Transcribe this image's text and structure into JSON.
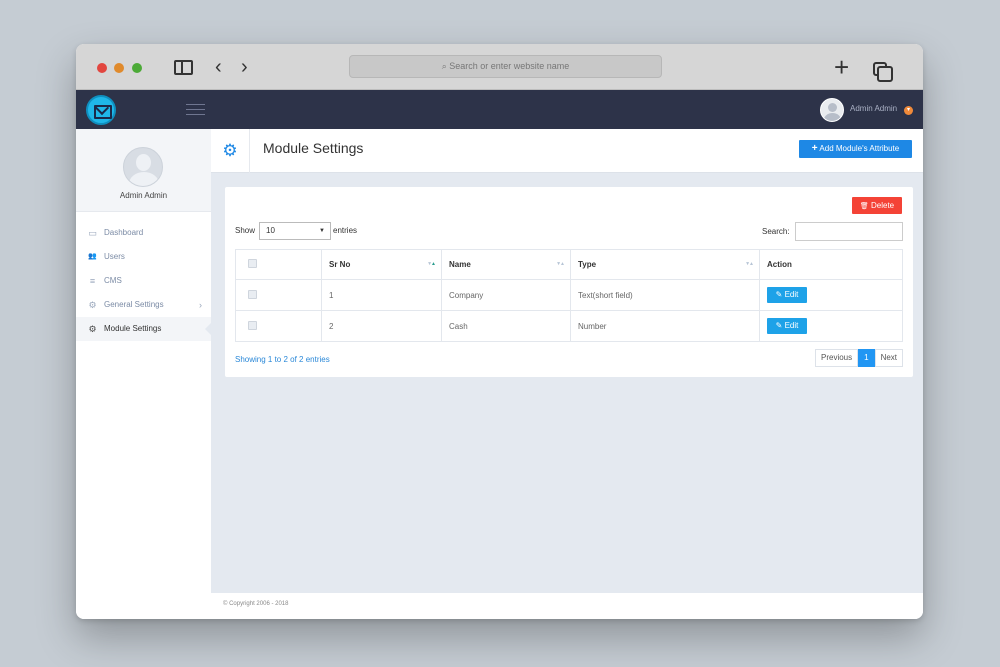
{
  "browser": {
    "url_placeholder": "Search or enter website name",
    "back_symbol": "‹",
    "forward_symbol": "›",
    "new_tab_symbol": "+"
  },
  "topbar": {
    "username": "Admin Admin",
    "logo_icon": "mail-icon",
    "colors": {
      "bar": "#2d3349",
      "logo": "#1fb7e9",
      "caret": "#f08a3a"
    }
  },
  "sidebar": {
    "profile_name": "Admin Admin",
    "items": [
      {
        "label": "Dashboard",
        "icon": "laptop-icon",
        "glyph": "▭",
        "active": false
      },
      {
        "label": "Users",
        "icon": "users-icon",
        "glyph": "👥",
        "active": false
      },
      {
        "label": "CMS",
        "icon": "list-icon",
        "glyph": "≡",
        "active": false
      },
      {
        "label": "General Settings",
        "icon": "cogs-icon",
        "glyph": "⚙",
        "active": false,
        "has_submenu": true
      },
      {
        "label": "Module Settings",
        "icon": "gear-icon",
        "glyph": "⚙",
        "active": true
      }
    ]
  },
  "header": {
    "title": "Module Settings",
    "add_button_label": "Add Module's Attribute",
    "add_icon": "+",
    "accent": "#1e88e5"
  },
  "panel": {
    "delete_label": "Delete",
    "delete_icon": "🗑",
    "delete_color": "#f44336",
    "show_label": "Show",
    "page_size": "10",
    "entries_label": "entries",
    "search_label": "Search:",
    "search_value": "",
    "columns": [
      "",
      "Sr No",
      "Name",
      "Type",
      "Action"
    ],
    "rows": [
      {
        "sr": "1",
        "name": "Company",
        "type": "Text(short field)",
        "action": "Edit"
      },
      {
        "sr": "2",
        "name": "Cash",
        "type": "Number",
        "action": "Edit"
      }
    ],
    "showing_text": "Showing 1 to 2 of 2 entries",
    "pagination": {
      "previous": "Previous",
      "current": "1",
      "next": "Next"
    }
  },
  "footer": {
    "copyright": "© Copyright 2006 - 2018"
  }
}
